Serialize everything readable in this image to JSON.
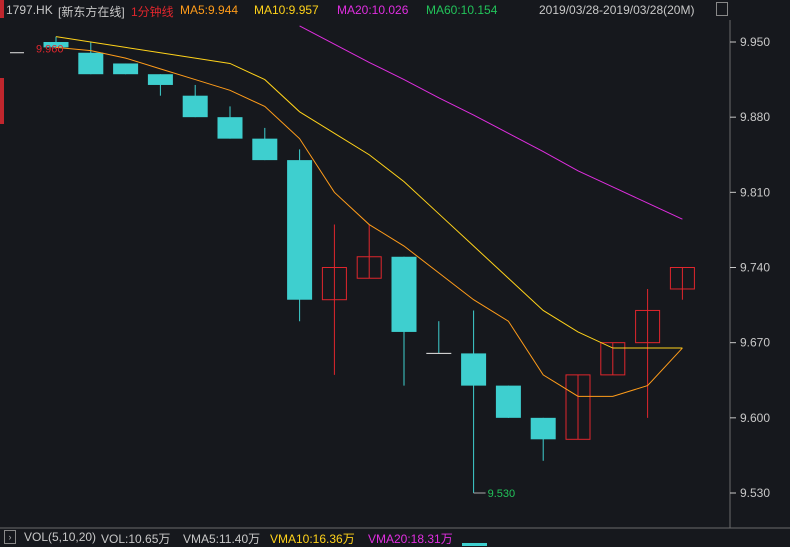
{
  "header": {
    "stock": "1797.HK",
    "name": "[新东方在线]",
    "period": "1分钟线",
    "ma5": "MA5:9.944",
    "ma10": "MA10:9.957",
    "ma20": "MA20:10.026",
    "ma60": "MA60:10.154",
    "range": "2019/03/28-2019/03/28(20M)"
  },
  "footer": {
    "vol_label": "VOL(5,10,20)",
    "vol": "VOL:10.65万",
    "vma5": "VMA5:11.40万",
    "vma10": "VMA10:16.36万",
    "vma20": "VMA20:18.31万"
  },
  "colors": {
    "bg": "#16181d",
    "up": "#e0262d",
    "down": "#3ecfcf",
    "ma5": "#ff9c1a",
    "ma10": "#ffd21a",
    "ma20": "#e02ee0",
    "ma60": "#22c35a",
    "axis": "#c8c8c8"
  },
  "chart_data": {
    "type": "candlestick",
    "ylim": [
      9.52,
      9.975
    ],
    "yticks": [
      "9.950",
      "9.880",
      "9.810",
      "9.740",
      "9.670",
      "9.600",
      "9.530"
    ],
    "annotations": {
      "high_label": "9.960",
      "low_label": "9.530"
    },
    "candles": [
      {
        "o": 9.95,
        "h": 9.955,
        "l": 9.945,
        "c": 9.945
      },
      {
        "o": 9.94,
        "h": 9.95,
        "l": 9.92,
        "c": 9.92
      },
      {
        "o": 9.93,
        "h": 9.93,
        "l": 9.92,
        "c": 9.92
      },
      {
        "o": 9.92,
        "h": 9.92,
        "l": 9.9,
        "c": 9.91
      },
      {
        "o": 9.9,
        "h": 9.91,
        "l": 9.88,
        "c": 9.88
      },
      {
        "o": 9.88,
        "h": 9.89,
        "l": 9.86,
        "c": 9.86
      },
      {
        "o": 9.86,
        "h": 9.87,
        "l": 9.84,
        "c": 9.84
      },
      {
        "o": 9.84,
        "h": 9.85,
        "l": 9.69,
        "c": 9.71
      },
      {
        "o": 9.71,
        "h": 9.78,
        "l": 9.64,
        "c": 9.74
      },
      {
        "o": 9.73,
        "h": 9.78,
        "l": 9.73,
        "c": 9.75
      },
      {
        "o": 9.75,
        "h": 9.75,
        "l": 9.63,
        "c": 9.68
      },
      {
        "o": 9.66,
        "h": 9.69,
        "l": 9.66,
        "c": 9.66
      },
      {
        "o": 9.66,
        "h": 9.7,
        "l": 9.53,
        "c": 9.63
      },
      {
        "o": 9.63,
        "h": 9.63,
        "l": 9.6,
        "c": 9.6
      },
      {
        "o": 9.6,
        "h": 9.6,
        "l": 9.56,
        "c": 9.58
      },
      {
        "o": 9.58,
        "h": 9.64,
        "l": 9.58,
        "c": 9.64
      },
      {
        "o": 9.64,
        "h": 9.67,
        "l": 9.64,
        "c": 9.67
      },
      {
        "o": 9.67,
        "h": 9.72,
        "l": 9.6,
        "c": 9.7
      },
      {
        "o": 9.72,
        "h": 9.74,
        "l": 9.71,
        "c": 9.74
      }
    ],
    "ma5": [
      9.945,
      9.942,
      9.935,
      9.925,
      9.915,
      9.905,
      9.89,
      9.86,
      9.81,
      9.78,
      9.76,
      9.735,
      9.71,
      9.69,
      9.64,
      9.62,
      9.62,
      9.63,
      9.665
    ],
    "ma10": [
      9.955,
      9.95,
      9.945,
      9.94,
      9.935,
      9.93,
      9.915,
      9.885,
      9.865,
      9.845,
      9.82,
      9.79,
      9.76,
      9.73,
      9.7,
      9.68,
      9.665,
      9.665,
      9.665
    ],
    "ma20": [
      null,
      null,
      null,
      null,
      null,
      null,
      null,
      9.965,
      9.948,
      9.931,
      9.915,
      9.898,
      9.882,
      9.865,
      9.848,
      9.83,
      9.815,
      9.8,
      9.785
    ]
  }
}
